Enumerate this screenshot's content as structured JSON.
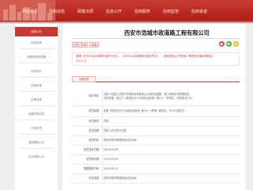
{
  "nav": [
    "网站首页",
    "信用动态",
    "政策法规",
    "信息公开",
    "信用服务",
    "信用监管",
    "信用承诺"
  ],
  "sidebar": {
    "items": [
      {
        "label": "信息公示"
      },
      {
        "label": "信息查询"
      },
      {
        "label": "双随机抽查结果"
      },
      {
        "label": "信用评价"
      },
      {
        "label": "信用承诺"
      },
      {
        "label": "红黑名单"
      },
      {
        "label": "经营异常名录"
      },
      {
        "label": "行政处罚"
      },
      {
        "label": "信用修复公示"
      },
      {
        "label": "企业信用公示"
      }
    ]
  },
  "main": {
    "title": "西安市浩城市政道路工程有限公司",
    "buttons": {
      "share": "分享 | 打印",
      "report": "纠错"
    },
    "basis_line1": "依据《中华人民共和国行政许可法》、《中华人民共和国行政处罚法》、《政府信息公开条例》等相关法律法规规定",
    "basis_line2": "予以公示",
    "tab": "行政处罚",
    "rows": [
      {
        "label": "违法事实",
        "lines": [
          "当事人在施工过程中未按规定采取扬尘污染防治措施，施工现场未设置围挡及",
          "冲洗设施，违反了《陕西省大气污染防治条例》第六十一条规定，构成违法行为。"
        ]
      },
      {
        "label": "处罚依据",
        "lines": [
          "依据《陕西省大气污染防治条例》第九十八条第一款规定，予以行政处罚。"
        ]
      },
      {
        "label": "处罚种类",
        "lines": [
          "罚款"
        ]
      },
      {
        "label": "处罚结果",
        "lines": [
          "罚款人民币壹万元整"
        ]
      },
      {
        "label": "处罚机关",
        "lines": [
          "西安市城市管理和综合执法局"
        ]
      },
      {
        "label": "处罚决定日期",
        "lines": [
          "2023/05/08"
        ]
      },
      {
        "label": "处罚有效期",
        "lines": [
          "2024/05/08"
        ]
      },
      {
        "label": "数据更新时间",
        "lines": [
          "2023/05/10"
        ]
      },
      {
        "label": "信息来源",
        "lines": [
          "西安市城市管理和综合执法局"
        ]
      }
    ]
  },
  "colors": {
    "brand_red": "#c63a33"
  },
  "icons": [
    "share-weibo-icon",
    "share-wechat-icon",
    "share-qzone-icon"
  ]
}
